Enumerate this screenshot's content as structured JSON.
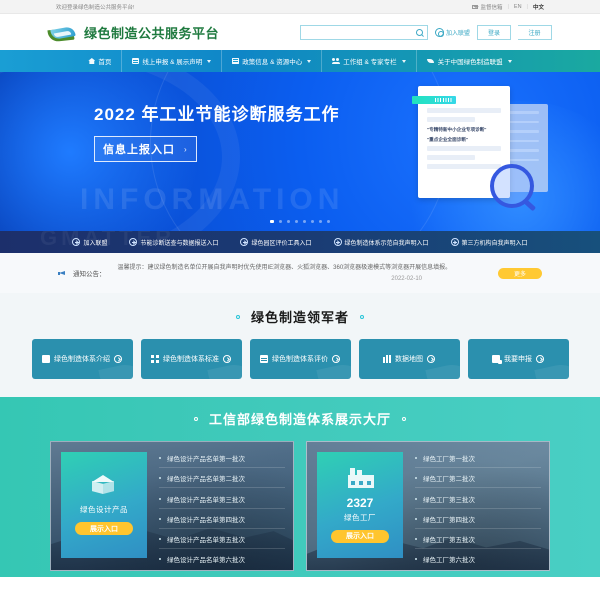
{
  "topbar": {
    "welcome": "欢迎登录绿色制造公共服务平台!",
    "mailbox": "监督信箱",
    "sep": "|",
    "lang_en": "EN",
    "lang_cn": "中文"
  },
  "header": {
    "brand_name": "绿色制造公共服务平台",
    "search_value": "",
    "search_placeholder": "",
    "join_label": "加入联盟",
    "login_label": "登录",
    "register_label": "注册"
  },
  "nav": {
    "items": [
      {
        "label": "首页",
        "icon": "home-icon",
        "caret": false
      },
      {
        "label": "线上申报 & 展示声明",
        "icon": "document-icon",
        "caret": true
      },
      {
        "label": "政策信息 & 资源中心",
        "icon": "book-icon",
        "caret": true
      },
      {
        "label": "工作组 & 专家专栏",
        "icon": "users-icon",
        "caret": true
      },
      {
        "label": "关于中国绿色制造联盟",
        "icon": "leaf-icon",
        "caret": true
      }
    ]
  },
  "hero": {
    "watermark": "INFORMATION",
    "title": "2022 年工业节能诊断服务工作",
    "button_label": "信息上报入口",
    "button_arrow": "›",
    "doc_quote_line1": "\"专精特新中小企业专项诊断\"",
    "doc_quote_line2": "\"重点企业全面诊断\"",
    "dots_total": 8,
    "dot_active_index": 0
  },
  "quicklinks": {
    "watermark": "GMATTER",
    "items": [
      "加入联盟",
      "节能诊断送查与数据报送入口",
      "绿色园区评价工具入口",
      "绿色制造体系示范自我声明入口",
      "第三方机构自我声明入口"
    ]
  },
  "notice": {
    "label": "通知公告：",
    "text": "温馨提示：建议绿色制造名单位开展自我声明时优先使用IE浏览器、火狐浏览器、360浏览器极速模式等浏览器开展信息填报。",
    "date": "2022-02-10",
    "more_label": "更多"
  },
  "leaders": {
    "title": "绿色制造领军者",
    "cards": [
      {
        "label": "绿色制造体系介绍",
        "icon": "square-icon"
      },
      {
        "label": "绿色制造体系标准",
        "icon": "grid-icon"
      },
      {
        "label": "绿色制造体系评价",
        "icon": "card-icon"
      },
      {
        "label": "数据地图",
        "icon": "bar-chart-icon"
      },
      {
        "label": "我要申报",
        "icon": "form-icon"
      }
    ]
  },
  "showcase": {
    "title": "工信部绿色制造体系展示大厅",
    "panels": [
      {
        "icon": "cube-icon",
        "count": "",
        "name": "绿色设计产品",
        "button_label": "展示入口",
        "items": [
          "绿色设计产品名单第一批次",
          "绿色设计产品名单第二批次",
          "绿色设计产品名单第三批次",
          "绿色设计产品名单第四批次",
          "绿色设计产品名单第五批次",
          "绿色设计产品名单第六批次"
        ]
      },
      {
        "icon": "factory-icon",
        "count": "2327",
        "name": "绿色工厂",
        "button_label": "展示入口",
        "items": [
          "绿色工厂第一批次",
          "绿色工厂第二批次",
          "绿色工厂第三批次",
          "绿色工厂第四批次",
          "绿色工厂第五批次",
          "绿色工厂第六批次"
        ]
      }
    ]
  },
  "colors": {
    "brand_green": "#1f7a3f",
    "nav_blue": "#1a9ed4",
    "hero_blue": "#0b5ef0",
    "accent_teal": "#35c7b4",
    "accent_yellow": "#ffc52e",
    "card_blue": "#2b90ae"
  }
}
